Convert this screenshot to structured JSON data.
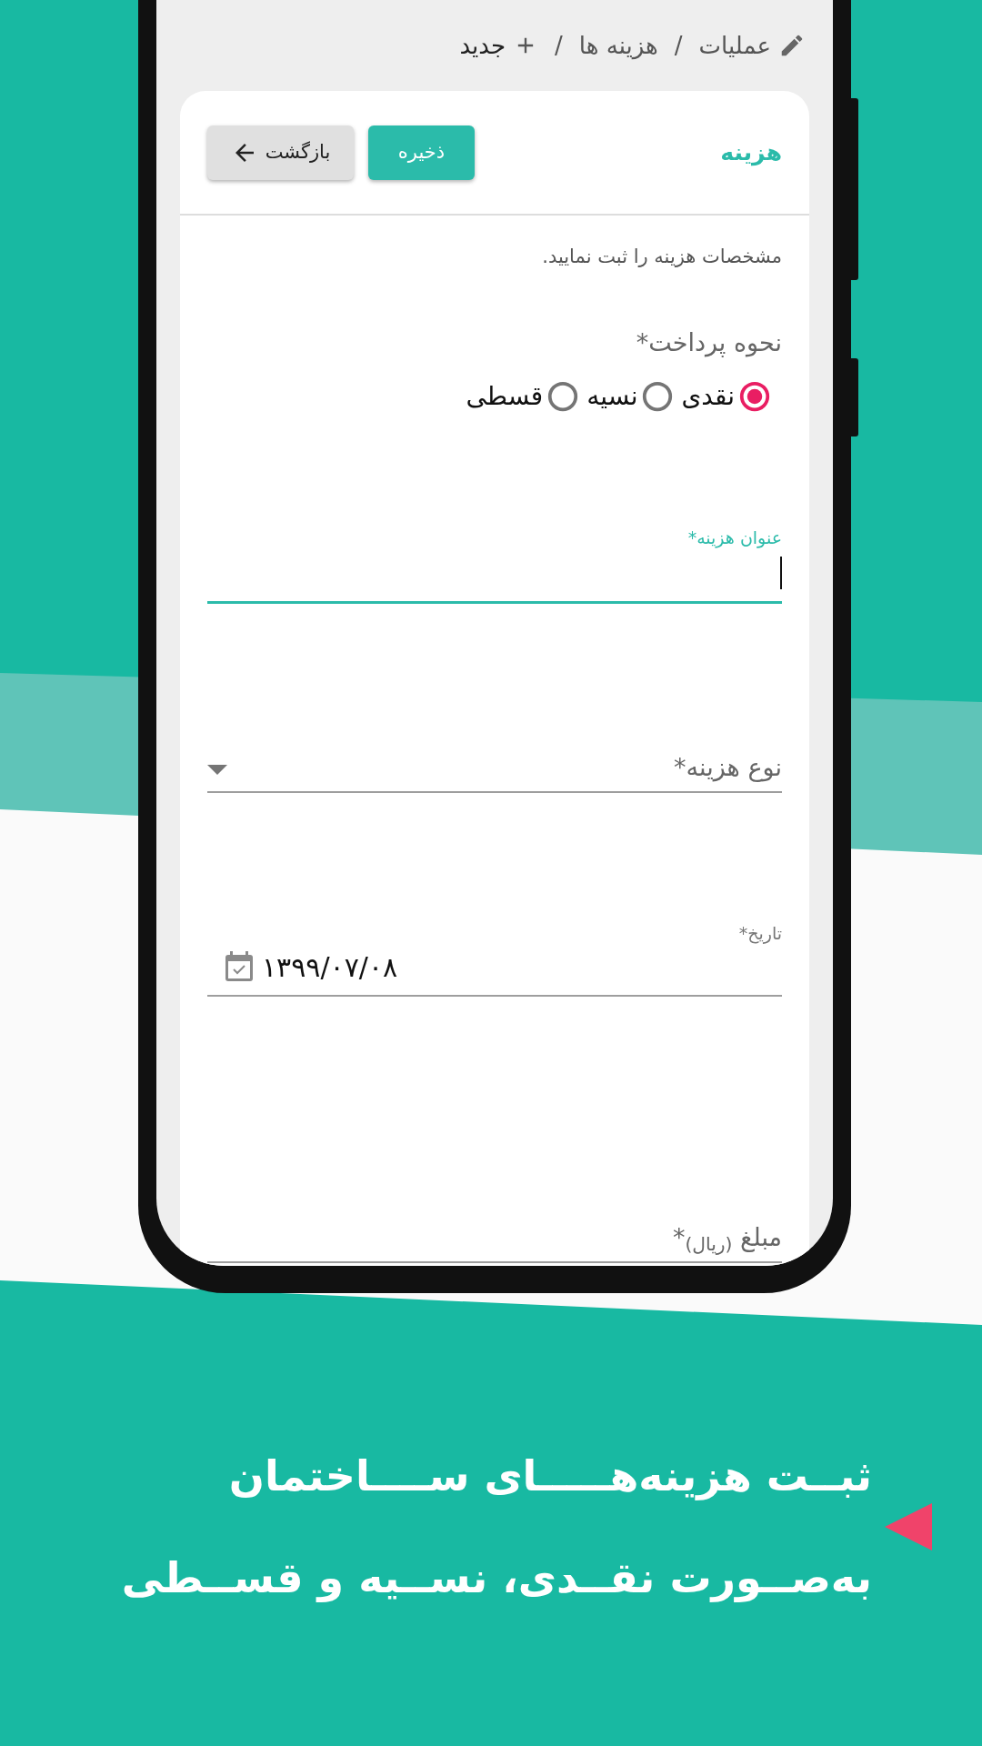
{
  "breadcrumb": [
    {
      "kind": "link",
      "label": "عملیات"
    },
    {
      "kind": "separator",
      "label": "/"
    },
    {
      "kind": "link",
      "label": "هزینه ها"
    },
    {
      "kind": "separator",
      "label": "/"
    },
    {
      "kind": "current",
      "label": "جدید"
    }
  ],
  "card": {
    "title": "هزینه",
    "buttons": [
      {
        "kind": "primary",
        "label": "ذخیره"
      },
      {
        "kind": "back",
        "label": "بازگشت"
      }
    ],
    "description": "مشخصات هزینه را ثبت نمایید.",
    "payment_method": {
      "label": "نحوه پرداخت*",
      "options": [
        {
          "label": "نقدی",
          "selected": true
        },
        {
          "label": "نسیه",
          "selected": false
        },
        {
          "label": "قسطی",
          "selected": false
        }
      ]
    },
    "fields": [
      {
        "kind": "text",
        "label": "عنوان هزینه*",
        "focused": true
      },
      {
        "kind": "select",
        "label": "نوع هزینه*",
        "focused": false
      },
      {
        "kind": "date",
        "label": "تاریخ*",
        "value": "۱۳۹۹/۰۷/۰۸",
        "focused": false
      },
      {
        "kind": "amount",
        "label": "مبلغ $_{(ریال)}$*",
        "focused": false
      }
    ]
  },
  "promo": {
    "lines": [
      "ثبــت هزینه‌هـــــای ســــاختمان",
      "به‌صــورت نقــدی، نســیه و قســطی"
    ]
  }
}
